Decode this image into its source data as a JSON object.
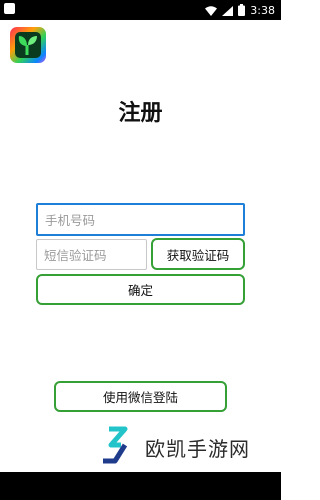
{
  "status_bar": {
    "time": "3:38",
    "icons": [
      "app-notification-icon",
      "wifi-icon",
      "signal-icon",
      "battery-icon"
    ]
  },
  "app": {
    "logo_icon": "sprout-logo-icon"
  },
  "page": {
    "title": "注册"
  },
  "form": {
    "phone_placeholder": "手机号码",
    "code_placeholder": "短信验证码",
    "get_code_label": "获取验证码",
    "confirm_label": "确定"
  },
  "social": {
    "wechat_login_label": "使用微信登陆"
  },
  "watermark": {
    "text": "欧凯手游网"
  },
  "colors": {
    "accent_border": "#35a035",
    "focus_border": "#1e7fd8"
  }
}
